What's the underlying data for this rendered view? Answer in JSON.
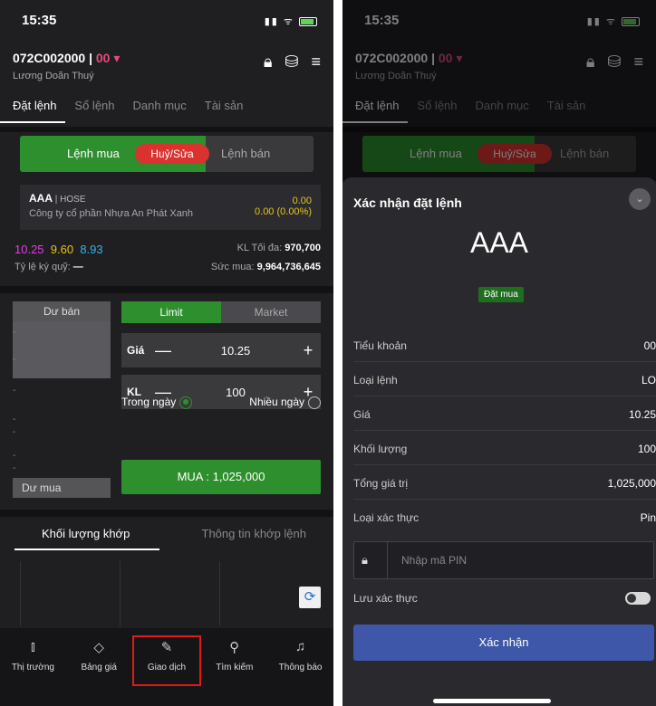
{
  "status": {
    "time": "15:35"
  },
  "account": {
    "id": "072C002000 | ",
    "sub": "00",
    "name": "Lương Doãn Thuý"
  },
  "tabs": [
    "Đặt lệnh",
    "Sổ lệnh",
    "Danh mục",
    "Tài sản"
  ],
  "segment": {
    "buy": "Lệnh mua",
    "cancel": "Huỷ/Sửa",
    "sell": "Lệnh bán"
  },
  "stock": {
    "symbol": "AAA",
    "exchange": " | HOSE",
    "company": "Công ty cổ phần Nhựa An Phát Xanh",
    "change": "0.00",
    "change_pct": "0.00 (0.00%)"
  },
  "prices": {
    "ceiling": "10.25",
    "reference": "9.60",
    "floor": "8.93"
  },
  "info": {
    "max_label": "KL Tối đa: ",
    "max_value": "970,700",
    "margin_label": "Tỷ lệ ký quỹ: ",
    "margin_value": "—",
    "power_label": "Sức mua: ",
    "power_value": "9,964,736,645"
  },
  "orderbook": {
    "ask_label": "Dư bán",
    "bid_label": "Dư mua",
    "dash": "-"
  },
  "order_type": {
    "limit": "Limit",
    "market": "Market"
  },
  "price_field": {
    "label": "Giá",
    "value": "10.25"
  },
  "qty_field": {
    "label": "KL",
    "value": "100"
  },
  "validity": {
    "day": "Trong ngày",
    "multi": "Nhiều ngày"
  },
  "buy_button": "MUA : 1,025,000",
  "match_tabs": {
    "volume": "Khối lượng khớp",
    "info": "Thông tin khớp lệnh"
  },
  "nav": [
    {
      "label": "Thị trường",
      "icon": "chart-icon"
    },
    {
      "label": "Bảng giá",
      "icon": "tag-icon"
    },
    {
      "label": "Giao dịch",
      "icon": "trade-icon"
    },
    {
      "label": "Tìm kiếm",
      "icon": "search-icon"
    },
    {
      "label": "Thông báo",
      "icon": "bell-icon"
    }
  ],
  "confirm_sheet": {
    "title": "Xác nhận đặt lệnh",
    "symbol": "AAA",
    "badge": "Đặt mua",
    "rows": [
      {
        "label": "Tiểu khoản",
        "value": "00"
      },
      {
        "label": "Loại lệnh",
        "value": "LO"
      },
      {
        "label": "Giá",
        "value": "10.25"
      },
      {
        "label": "Khối lượng",
        "value": "100"
      },
      {
        "label": "Tổng giá trị",
        "value": "1,025,000"
      },
      {
        "label": "Loại xác thực",
        "value": "Pin"
      }
    ],
    "pin_placeholder": "Nhập mã PIN",
    "save_label": "Lưu xác thực",
    "confirm_button": "Xác nhận"
  },
  "colors": {
    "buy_green": "#2d8f2d",
    "cancel_red": "#d9322f",
    "confirm_blue": "#3f57a8",
    "ceiling": "#e03ee0",
    "reference": "#e8c414",
    "floor": "#2fb8e6"
  }
}
